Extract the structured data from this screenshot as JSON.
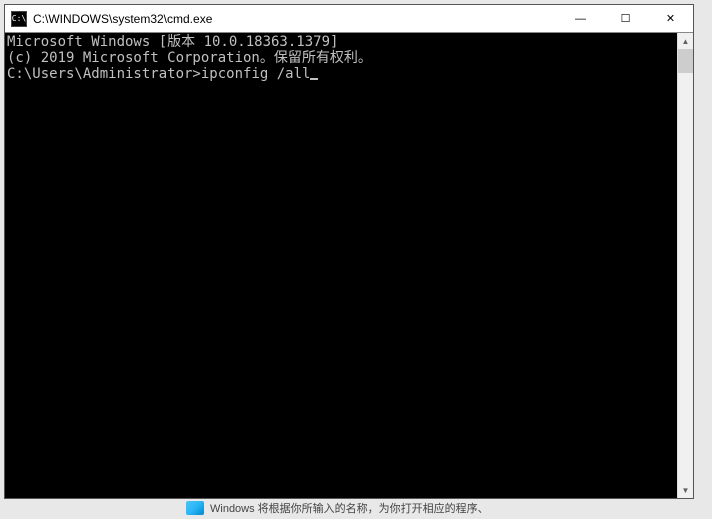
{
  "window": {
    "title": "C:\\WINDOWS\\system32\\cmd.exe",
    "icon_label": "C:\\"
  },
  "console": {
    "line1": "Microsoft Windows [版本 10.0.18363.1379]",
    "line2": "(c) 2019 Microsoft Corporation。保留所有权利。",
    "blank": "",
    "prompt": "C:\\Users\\Administrator>",
    "command": "ipconfig /all"
  },
  "controls": {
    "minimize": "—",
    "maximize": "☐",
    "close": "✕"
  },
  "background": {
    "hint_text": "Windows 将根据你所输入的名称，为你打开相应的程序、"
  }
}
